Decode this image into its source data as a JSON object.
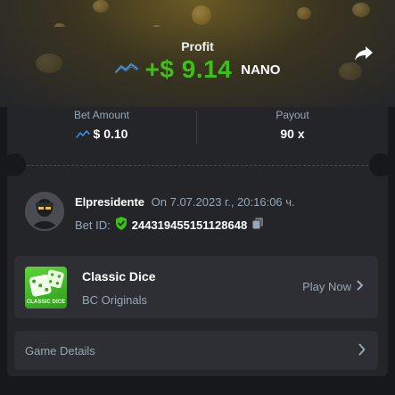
{
  "header": {
    "profit_label": "Profit",
    "profit_amount": "+$ 9.14",
    "currency": "NANO"
  },
  "stats": {
    "bet_amount_label": "Bet Amount",
    "bet_amount_value": "$ 0.10",
    "payout_label": "Payout",
    "payout_value": "90 x"
  },
  "user": {
    "username": "Elpresidente",
    "date": "On 7.07.2023 г., 20:16:06 ч.",
    "bet_id_label": "Bet ID:",
    "bet_id": "244319455151128648"
  },
  "game": {
    "title": "Classic Dice",
    "subtitle": "BC Originals",
    "thumb_text": "CLASSIC DICE",
    "play_label": "Play Now"
  },
  "details": {
    "label": "Game Details"
  },
  "colors": {
    "profit_green": "#3bc117",
    "muted_text": "#98a7b5",
    "card_bg": "#232529",
    "panel_bg": "#2d2f34",
    "page_bg": "#17181b",
    "chart_icon_blue": "#3b8cd9"
  },
  "icons": {
    "currency_icon": "trend-line-icon",
    "share": "share-arrow-icon",
    "verified": "shield-check-icon",
    "copy": "copy-icon",
    "chevron": "chevron-right-icon"
  }
}
